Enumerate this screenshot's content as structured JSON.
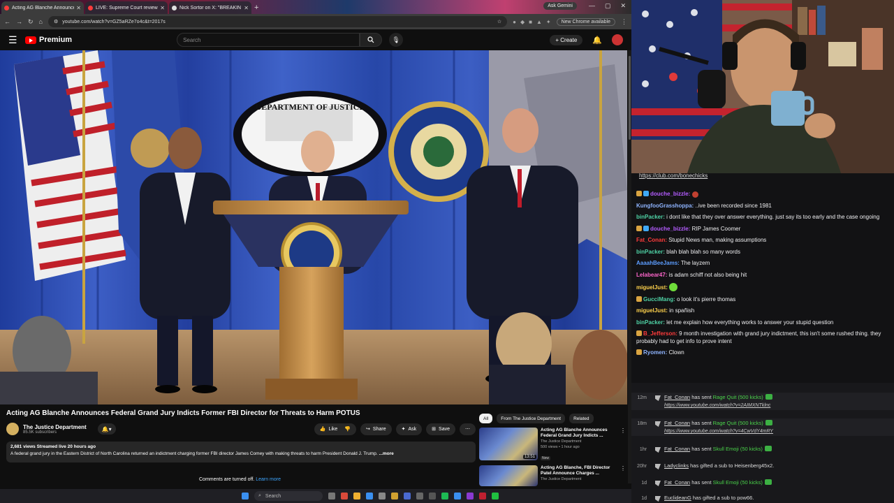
{
  "browser": {
    "tabs": [
      {
        "title": "Acting AG Blanche Announces",
        "color": "#ff3b3b",
        "active": true
      },
      {
        "title": "LIVE: Supreme Court reviews T",
        "color": "#ff3b3b",
        "active": false
      },
      {
        "title": "Nick Sortor on X: \"BREAKIN",
        "color": "#e0e0e0",
        "active": false
      }
    ],
    "new_tab": "+",
    "ask_gemini": "Ask Gemini",
    "url": "youtube.com/watch?v=GZ5aRZe7o4c&t=2017s",
    "new_chrome": "New Chrome available"
  },
  "youtube": {
    "logo": "Premium",
    "search_placeholder": "Search",
    "create_label": "Create",
    "video_title": "Acting AG Blanche Announces Federal Grand Jury Indicts Former FBI Director for Threats to Harm POTUS",
    "channel_name": "The Justice Department",
    "subscribers": "85.5K subscribers",
    "actions": [
      "Like",
      "Share",
      "Ask",
      "Save"
    ],
    "description_meta": "2,681 views  Streamed live 20 hours ago",
    "description_text": "A federal grand jury in the Eastern District of North Carolina returned an indictment charging former FBI director James Comey with making threats to harm President Donald J. Trump.",
    "more_label": "...more",
    "comments_off": "Comments are turned off.",
    "learn_more": "Learn more",
    "chips": [
      "All",
      "From The Justice Department",
      "Related"
    ],
    "related": [
      {
        "title": "Acting AG Blanche Announces Federal Grand Jury Indicts ...",
        "channel": "The Justice Department",
        "meta": "500 views • 1 hour ago",
        "badge": "New",
        "duration": "13:51"
      },
      {
        "title": "Acting AG Blanche, FBI Director Patel Announce Charges ...",
        "channel": "The Justice Department",
        "meta": "",
        "badge": "",
        "duration": ""
      }
    ],
    "podium_seal_text": "DEPARTMENT OF JUSTICE",
    "backdrop_text": "DEPARTMENT OF JUSTICE"
  },
  "taskbar": {
    "search": "Search"
  },
  "chat": {
    "top_link": "https://club.com/bonechicks",
    "messages": [
      {
        "user": "douche_bizzle:",
        "color": "#b45cff",
        "text": "",
        "badges": [
          "#d9a441",
          "#3fa9f5"
        ],
        "emote": "heart"
      },
      {
        "user": "KungfooGrasshoppa:",
        "color": "#8fb4ff",
        "text": "..ive been recorded since 1981",
        "badges": []
      },
      {
        "user": "binPacker:",
        "color": "#4fd3a6",
        "text": "i dont like that they over answer everything. just say its too early and the case ongoing",
        "badges": []
      },
      {
        "user": "douche_bizzle:",
        "color": "#b45cff",
        "text": "RIP James Coomer",
        "badges": [
          "#d9a441",
          "#3fa9f5"
        ]
      },
      {
        "user": "Fat_Conan:",
        "color": "#ff3b3b",
        "text": "Stupid News man, making assumptions",
        "badges": []
      },
      {
        "user": "binPacker:",
        "color": "#4fd3a6",
        "text": "blah blah blah so many words",
        "badges": []
      },
      {
        "user": "AaaahBeeJams:",
        "color": "#5c9dff",
        "text": "The layzem",
        "badges": []
      },
      {
        "user": "Lelabear47:",
        "color": "#ff66cc",
        "text": "is adam schiff not also being hit",
        "badges": []
      },
      {
        "user": "miguelJust:",
        "color": "#ffd24d",
        "text": "",
        "badges": [],
        "emote": "green"
      },
      {
        "user": "GucciMang:",
        "color": "#4fd3a6",
        "text": "o look it's pierre thomas",
        "badges": [
          "#d9a441"
        ]
      },
      {
        "user": "miguelJust:",
        "color": "#ffd24d",
        "text": "in spañish",
        "badges": []
      },
      {
        "user": "binPacker:",
        "color": "#4fd3a6",
        "text": "let me explain how everything works to answer your stupid question",
        "badges": []
      },
      {
        "user": "B_Jefferson:",
        "color": "#ff3b3b",
        "text": "9 month investigation with grand jury indictment, this isn't some rushed thing. they probably had to get info to prove intent",
        "badges": [
          "#d9a441"
        ]
      },
      {
        "user": "Ryomen:",
        "color": "#8fb4ff",
        "text": "Clown",
        "badges": [
          "#d9a441"
        ]
      }
    ]
  },
  "events": [
    {
      "time": "12m",
      "user": "Fat_Conan",
      "action": "has sent",
      "gift": "Rage Quit (500 kicks)",
      "link": "https://www.youtube.com/watch?v=2AIMXNTklnc"
    },
    {
      "time": "18m",
      "user": "Fat_Conan",
      "action": "has sent",
      "gift": "Rage Quit (500 kicks)",
      "link": "https://www.youtube.com/watch?v=4CwVdY4mRY"
    },
    {
      "time": "1hr",
      "user": "Fat_Conan",
      "action": "has sent",
      "gift": "Skull Emoji (50 kicks)",
      "link": ""
    },
    {
      "time": "20hr",
      "user": "Ladyclinks",
      "action": "has gifted a sub to Heisenberg45x2.",
      "gift": "",
      "link": ""
    },
    {
      "time": "1d",
      "user": "Fat_Conan",
      "action": "has sent",
      "gift": "Skull Emoji (50 kicks)",
      "link": ""
    },
    {
      "time": "1d",
      "user": "EuclideanG",
      "action": "has gifted a sub to pow66.",
      "gift": "",
      "link": ""
    }
  ]
}
